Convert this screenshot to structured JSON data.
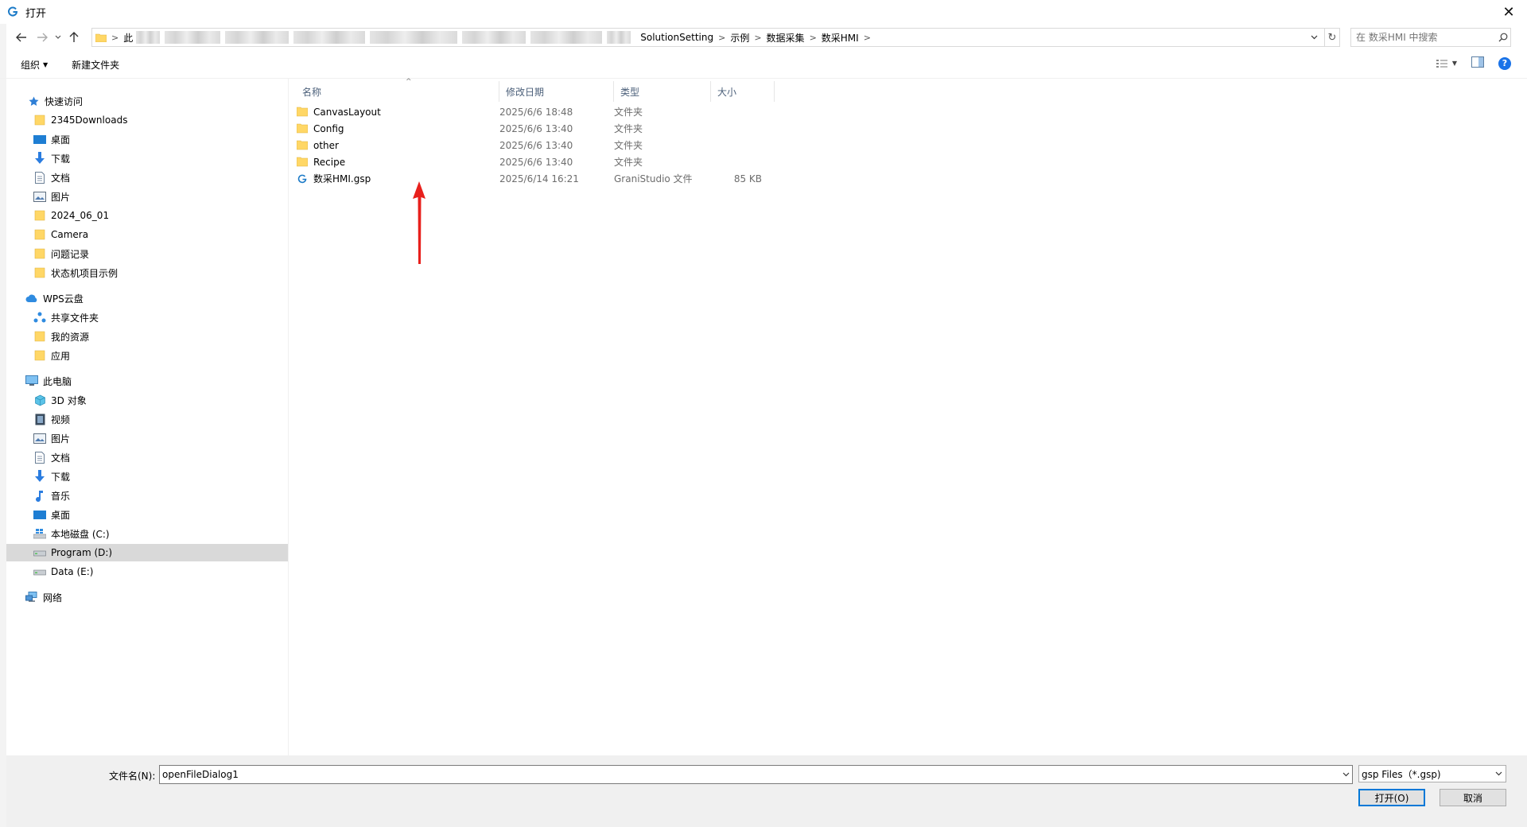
{
  "window": {
    "title": "打开",
    "close_glyph": "✕"
  },
  "nav": {
    "back_icon": "back-arrow-icon",
    "forward_icon": "forward-arrow-icon",
    "up_icon": "up-arrow-icon",
    "breadcrumb_first": "此",
    "breadcrumb": [
      "SolutionSetting",
      "示例",
      "数据采集",
      "数采HMI"
    ],
    "search_placeholder": "在 数采HMI 中搜索"
  },
  "toolbar": {
    "organize_label": "组织",
    "new_folder_label": "新建文件夹",
    "help_glyph": "?"
  },
  "sidebar": {
    "quick_access": {
      "label": "快速访问",
      "items": [
        "2345Downloads",
        "桌面",
        "下载",
        "文档",
        "图片",
        "2024_06_01",
        "Camera",
        "问题记录",
        "状态机项目示例"
      ]
    },
    "wps": {
      "label": "WPS云盘",
      "items": [
        "共享文件夹",
        "我的资源",
        "应用"
      ]
    },
    "this_pc": {
      "label": "此电脑",
      "items": [
        "3D 对象",
        "视频",
        "图片",
        "文档",
        "下载",
        "音乐",
        "桌面",
        "本地磁盘 (C:)",
        "Program (D:)",
        "Data (E:)"
      ]
    },
    "network": {
      "label": "网络"
    }
  },
  "columns": {
    "name": "名称",
    "modified": "修改日期",
    "type": "类型",
    "size": "大小"
  },
  "files": [
    {
      "name": "CanvasLayout",
      "modified": "2025/6/6 18:48",
      "type": "文件夹",
      "size": ""
    },
    {
      "name": "Config",
      "modified": "2025/6/6 13:40",
      "type": "文件夹",
      "size": ""
    },
    {
      "name": "other",
      "modified": "2025/6/6 13:40",
      "type": "文件夹",
      "size": ""
    },
    {
      "name": "Recipe",
      "modified": "2025/6/6 13:40",
      "type": "文件夹",
      "size": ""
    },
    {
      "name": "数采HMI.gsp",
      "modified": "2025/6/14 16:21",
      "type": "GraniStudio 文件",
      "size": "85 KB"
    }
  ],
  "footer": {
    "filename_label": "文件名(N):",
    "filename_value": "openFileDialog1",
    "filter_value": "gsp Files（*.gsp)",
    "open_label": "打开(O)",
    "cancel_label": "取消"
  },
  "colors": {
    "selection": "#d9d9d9",
    "accent": "#0078d7",
    "folder": "#ffd766",
    "arrow": "#e8201c"
  }
}
